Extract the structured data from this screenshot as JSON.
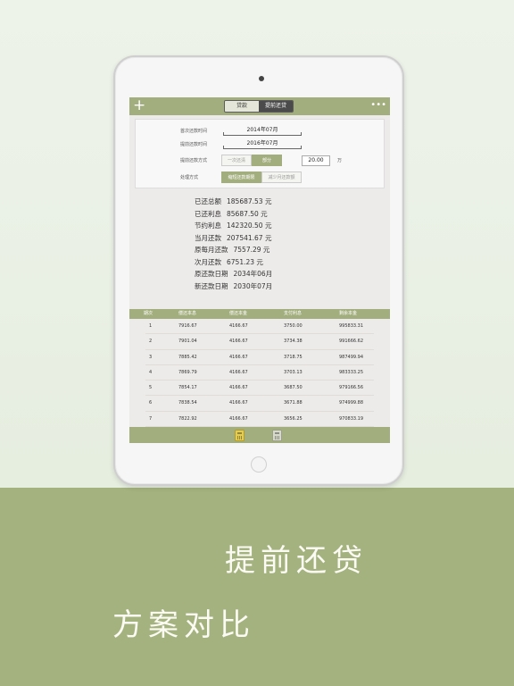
{
  "header": {
    "tabs": [
      {
        "label": "贷款",
        "active": false
      },
      {
        "label": "提前还贷",
        "active": true
      }
    ]
  },
  "form": {
    "rows": [
      {
        "label": "首次还款时间",
        "value": "2014年07月"
      },
      {
        "label": "提前还款时间",
        "value": "2016年07月"
      }
    ],
    "repay_method": {
      "label": "提前还款方式",
      "options": [
        {
          "label": "一次还清",
          "on": false
        },
        {
          "label": "部分",
          "on": true
        }
      ],
      "amount": "20.00",
      "unit": "万"
    },
    "handle_method": {
      "label": "处理方式",
      "options": [
        {
          "label": "缩短还款期限",
          "on": true
        },
        {
          "label": "减少月还款额",
          "on": false
        }
      ]
    }
  },
  "summary": [
    {
      "label": "已还总额",
      "value": "185687.53 元"
    },
    {
      "label": "已还利息",
      "value": "85687.50 元"
    },
    {
      "label": "节约利息",
      "value": "142320.50 元"
    },
    {
      "label": "当月还款",
      "value": "207541.67 元"
    },
    {
      "label": "原每月还款",
      "value": "7557.29 元"
    },
    {
      "label": "次月还款",
      "value": "6751.23 元"
    },
    {
      "label": "原还款日期",
      "value": "2034年06月"
    },
    {
      "label": "新还款日期",
      "value": "2030年07月"
    }
  ],
  "table": {
    "headers": [
      "期次",
      "偿还本息",
      "偿还本金",
      "支付利息",
      "剩余本金"
    ],
    "rows": [
      [
        "1",
        "7916.67",
        "4166.67",
        "3750.00",
        "995833.31"
      ],
      [
        "2",
        "7901.04",
        "4166.67",
        "3734.38",
        "991666.62"
      ],
      [
        "3",
        "7885.42",
        "4166.67",
        "3718.75",
        "987499.94"
      ],
      [
        "4",
        "7869.79",
        "4166.67",
        "3703.13",
        "983333.25"
      ],
      [
        "5",
        "7854.17",
        "4166.67",
        "3687.50",
        "979166.56"
      ],
      [
        "6",
        "7838.54",
        "4166.67",
        "3671.88",
        "974999.88"
      ],
      [
        "7",
        "7822.92",
        "4166.67",
        "3656.25",
        "970833.19"
      ]
    ]
  },
  "slogan": {
    "line1": "提前还贷",
    "line2": "方案对比"
  },
  "colors": {
    "accent": "#a3ae7e",
    "band": "#a4b27f"
  }
}
